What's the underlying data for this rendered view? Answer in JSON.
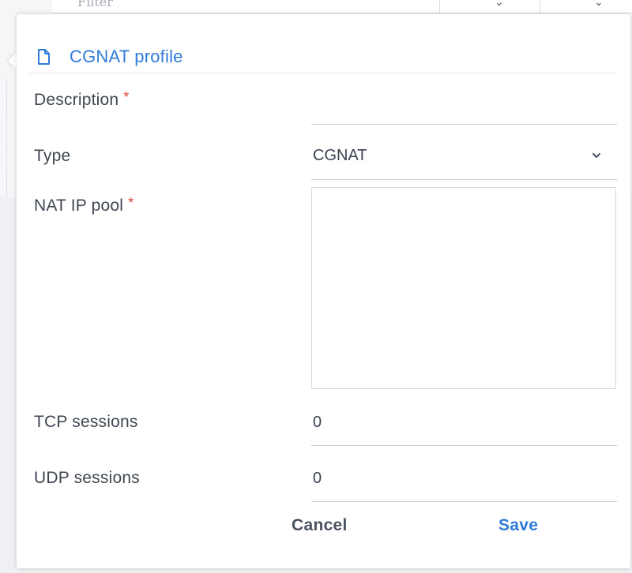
{
  "background": {
    "filter_placeholder": "Filter"
  },
  "panel": {
    "title": "CGNAT profile",
    "title_icon": "document-icon",
    "accent_color": "#2f7bd8",
    "required_color": "#e0403c"
  },
  "form": {
    "description": {
      "label": "Description",
      "required_marker": "*",
      "value": ""
    },
    "type": {
      "label": "Type",
      "value": "CGNAT"
    },
    "nat_ip_pool": {
      "label": "NAT IP pool",
      "required_marker": "*",
      "value": ""
    },
    "tcp_sessions": {
      "label": "TCP sessions",
      "value": "0"
    },
    "udp_sessions": {
      "label": "UDP sessions",
      "value": "0"
    }
  },
  "actions": {
    "cancel_label": "Cancel",
    "save_label": "Save"
  }
}
